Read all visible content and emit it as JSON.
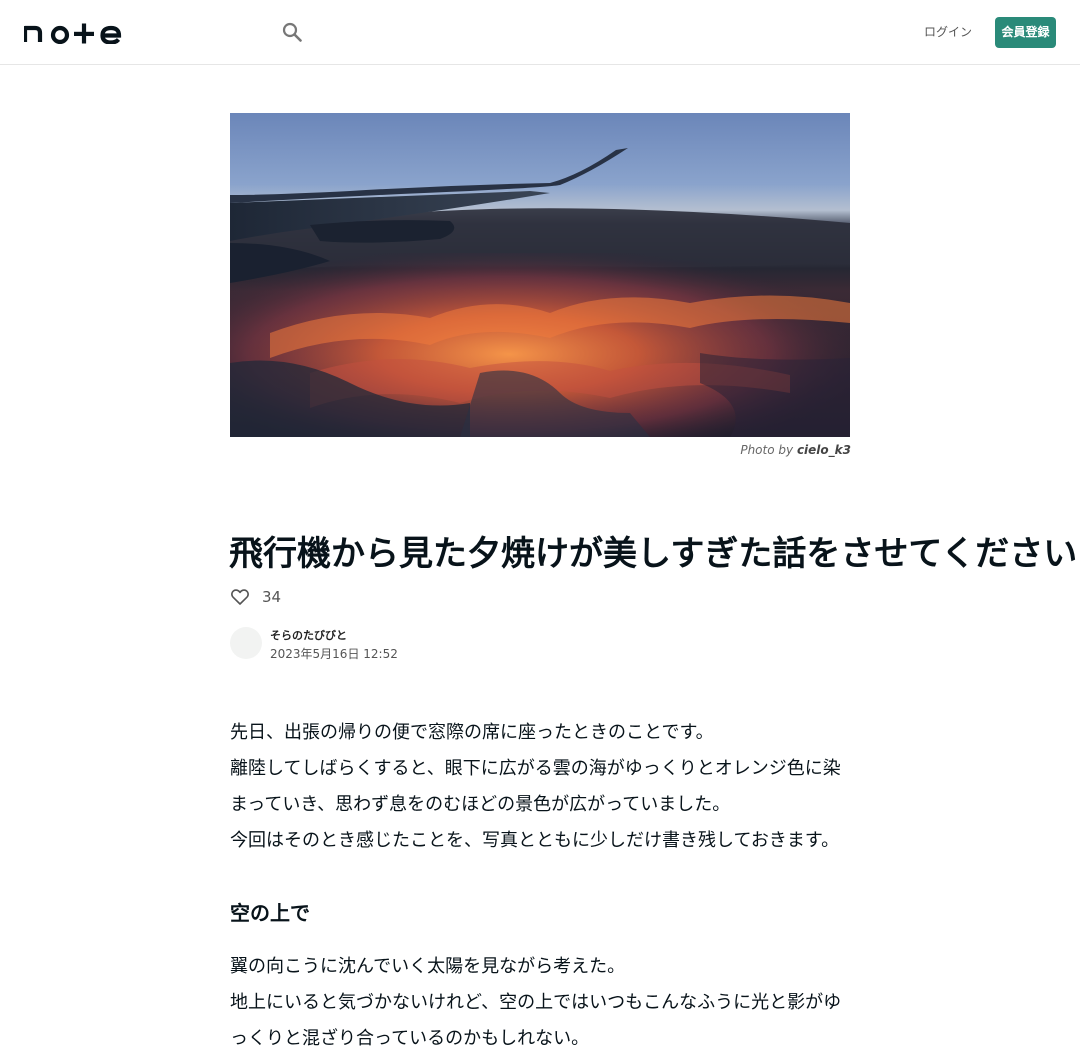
{
  "header": {
    "logo_text": "note",
    "search_icon": "search-icon",
    "login_label": "ログイン",
    "signup_label": "会員登録"
  },
  "hero": {
    "credit_prefix": "Photo by",
    "credit_name": "cielo_k3"
  },
  "article": {
    "title": "飛行機から見た夕焼けが美しすぎた話をさせてください",
    "like_count": "34",
    "author_name": "そらのたびびと",
    "date": "2023年5月16日 12:52",
    "paragraphs": [
      "先日、出張の帰りの便で窓際の席に座ったときのことです。",
      "離陸してしばらくすると、眼下に広がる雲の海がゆっくりとオレンジ色に染まっていき、思わず息をのむほどの景色が広がっていました。",
      "今回はそのとき感じたことを、写真とともに少しだけ書き残しておきます。"
    ],
    "section_heading": "空の上で",
    "section_paragraphs": [
      "翼の向こうに沈んでいく太陽を見ながら考えた。",
      "地上にいると気づかないけれど、空の上ではいつもこんなふうに光と影がゆっくりと混ざり合っているのかもしれない。"
    ]
  },
  "colors": {
    "brand": "#2a8a79",
    "text": "#08131a",
    "muted": "#555555"
  }
}
